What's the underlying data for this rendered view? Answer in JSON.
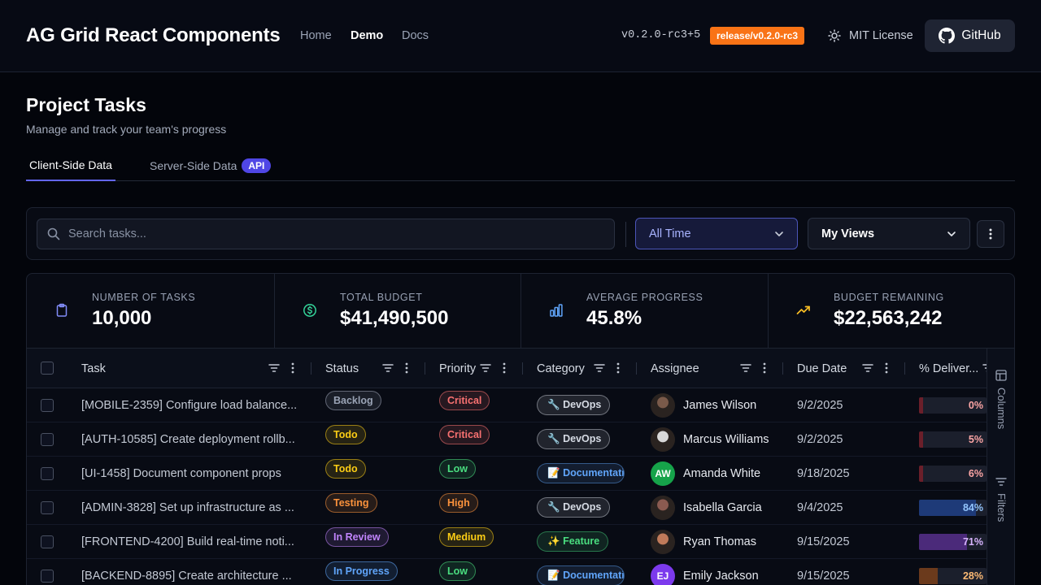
{
  "nav": {
    "brand": "AG Grid React Components",
    "links": [
      "Home",
      "Demo",
      "Docs"
    ],
    "version": "v0.2.0-rc3+5",
    "branch": "release/v0.2.0-rc3",
    "license": "MIT License",
    "github": "GitHub"
  },
  "page": {
    "title": "Project Tasks",
    "subtitle": "Manage and track your team's progress",
    "tabs": [
      {
        "label": "Client-Side Data",
        "active": true
      },
      {
        "label": "Server-Side Data",
        "active": false,
        "badge": "API"
      }
    ]
  },
  "toolbar": {
    "search_placeholder": "Search tasks...",
    "time_filter": "All Time",
    "views": "My Views"
  },
  "stats": [
    {
      "label": "NUMBER OF TASKS",
      "value": "10,000",
      "icon": "clipboard-icon",
      "color": "#818cf8"
    },
    {
      "label": "TOTAL BUDGET",
      "value": "$41,490,500",
      "icon": "dollar-circle-icon",
      "color": "#34d399"
    },
    {
      "label": "AVERAGE PROGRESS",
      "value": "45.8%",
      "icon": "bar-chart-icon",
      "color": "#60a5fa"
    },
    {
      "label": "BUDGET REMAINING",
      "value": "$22,563,242",
      "icon": "trending-up-icon",
      "color": "#fbbf24"
    }
  ],
  "grid": {
    "columns": [
      "Task",
      "Status",
      "Priority",
      "Category",
      "Assignee",
      "Due Date",
      "% Deliver..."
    ],
    "side_panel": [
      "Columns",
      "Filters"
    ],
    "rows": [
      {
        "task": "[MOBILE-2359] Configure load balance...",
        "status": "Backlog",
        "priority": "Critical",
        "category": "DevOps",
        "category_icon": "🔧",
        "assignee": "James Wilson",
        "avatar": "photo",
        "initials": "",
        "due": "9/2/2025",
        "progress": 0,
        "progress_label": "0%"
      },
      {
        "task": "[AUTH-10585] Create deployment rollb...",
        "status": "Todo",
        "priority": "Critical",
        "category": "DevOps",
        "category_icon": "🔧",
        "assignee": "Marcus Williams",
        "avatar": "photo",
        "initials": "",
        "due": "9/2/2025",
        "progress": 5,
        "progress_label": "5%"
      },
      {
        "task": "[UI-1458] Document component props",
        "status": "Todo",
        "priority": "Low",
        "category": "Documentation",
        "category_icon": "📝",
        "assignee": "Amanda White",
        "avatar": "initials",
        "initials": "AW",
        "due": "9/18/2025",
        "progress": 6,
        "progress_label": "6%"
      },
      {
        "task": "[ADMIN-3828] Set up infrastructure as ...",
        "status": "Testing",
        "priority": "High",
        "category": "DevOps",
        "category_icon": "🔧",
        "assignee": "Isabella Garcia",
        "avatar": "photo",
        "initials": "",
        "due": "9/4/2025",
        "progress": 84,
        "progress_label": "84%"
      },
      {
        "task": "[FRONTEND-4200] Build real-time noti...",
        "status": "In Review",
        "priority": "Medium",
        "category": "Feature",
        "category_icon": "✨",
        "assignee": "Ryan Thomas",
        "avatar": "photo",
        "initials": "",
        "due": "9/15/2025",
        "progress": 71,
        "progress_label": "71%"
      },
      {
        "task": "[BACKEND-8895] Create architecture ...",
        "status": "In Progress",
        "priority": "Low",
        "category": "Documentation",
        "category_icon": "📝",
        "assignee": "Emily Jackson",
        "avatar": "initials",
        "initials": "EJ",
        "due": "9/15/2025",
        "progress": 28,
        "progress_label": "28%"
      }
    ]
  },
  "colors": {
    "accent": "#6366f1",
    "branch_badge": "#f97316",
    "status": {
      "Backlog": "#9aa3b5",
      "Todo": "#facc15",
      "Testing": "#fb923c",
      "In Review": "#c084fc",
      "In Progress": "#60a5fa"
    },
    "priority": {
      "Critical": "#f87171",
      "High": "#fb923c",
      "Medium": "#facc15",
      "Low": "#4ade80"
    },
    "category": {
      "DevOps": "#d5dae3",
      "Documentation": "#60a5fa",
      "Feature": "#4ade80"
    },
    "avatar": {
      "AW": "#16a34a",
      "EJ": "#7c3aed"
    }
  }
}
